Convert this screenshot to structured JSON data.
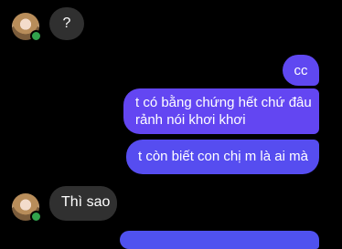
{
  "messages": [
    {
      "from": "contact",
      "text": "?"
    },
    {
      "from": "me",
      "text": "cc"
    },
    {
      "from": "me",
      "lines": [
        "t có bằng chứng hết chứ đâu",
        "rảnh nói khơi khơi"
      ]
    },
    {
      "from": "me",
      "text": "t còn biết con chị m là ai mà"
    },
    {
      "from": "contact",
      "text": "Thì sao"
    }
  ],
  "contact": {
    "online": true
  },
  "colors": {
    "incoming": "#303030",
    "outgoing": "#5f49f1",
    "online": "#31a24c"
  }
}
